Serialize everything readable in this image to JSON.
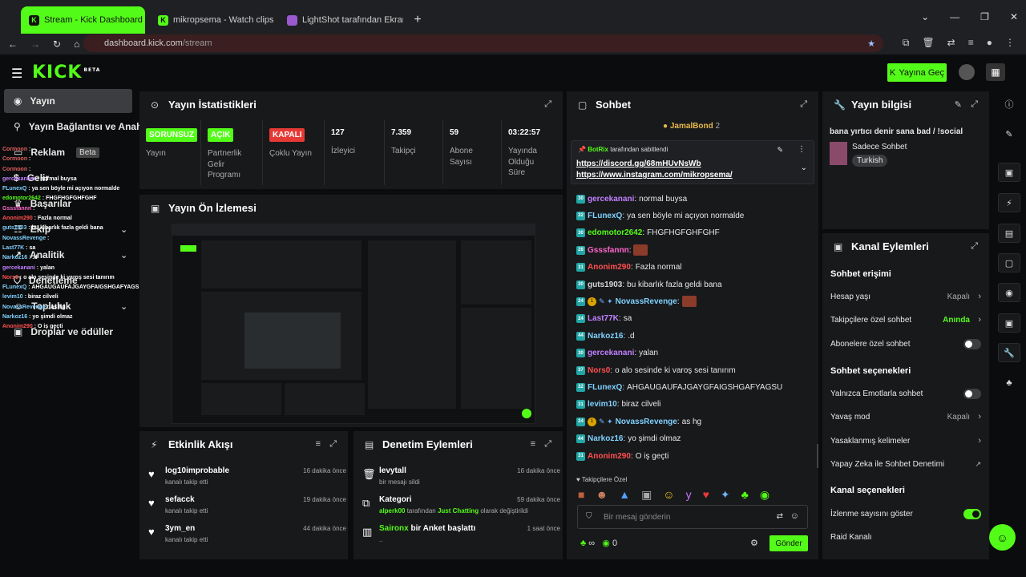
{
  "browser": {
    "tabs": [
      {
        "title": "Stream - Kick Dashboard",
        "active": true
      },
      {
        "title": "mikropsema - Watch clips on K",
        "active": false
      },
      {
        "title": "LightShot tarafından Ekran Gör",
        "active": false
      }
    ],
    "new_tab": "+",
    "url_host": "dashboard.kick.com",
    "url_path": "/stream"
  },
  "header": {
    "logo": "KICK",
    "logo_sup": "BETA",
    "go_live": "Yayına Geç"
  },
  "sidebar": {
    "items": [
      {
        "label": "Yayın",
        "icon": "play-circle-icon"
      },
      {
        "label": "Yayın Bağlantısı ve Anahtarı",
        "icon": "link-icon"
      },
      {
        "label": "Reklam",
        "icon": "ad-icon",
        "badge": "Beta"
      },
      {
        "label": "Gelir",
        "icon": "money-icon"
      },
      {
        "label": "Başarılar",
        "icon": "trophy-icon"
      },
      {
        "label": "Ekip",
        "icon": "team-icon"
      },
      {
        "label": "Analitik",
        "icon": "chart-icon"
      },
      {
        "label": "Denetleme",
        "icon": "shield-icon"
      },
      {
        "label": "Topluluk",
        "icon": "community-icon"
      },
      {
        "label": "Droplar ve ödüller",
        "icon": "gift-icon"
      }
    ],
    "overlay": [
      {
        "u": "Cormoon",
        "m": "",
        "c": "#e06060"
      },
      {
        "u": "Cormoon",
        "m": "",
        "c": "#e06060"
      },
      {
        "u": "Cormoon",
        "m": "",
        "c": "#e06060"
      },
      {
        "u": "gercekanani",
        "m": "normal buysa",
        "c": "#c080ff"
      },
      {
        "u": "FLunexQ",
        "m": "ya sen böyle mi açıyon normalde",
        "c": "#7fd1ff"
      },
      {
        "u": "edomotor2642",
        "m": "FHGFHGFGHFGHF",
        "c": "#53fc18"
      },
      {
        "u": "Gsssfannn",
        "m": "",
        "c": "#ff66cc"
      },
      {
        "u": "Anonim290",
        "m": "Fazla normal",
        "c": "#ff5050"
      },
      {
        "u": "guts1903",
        "m": "bu kibarlık fazla geldi bana",
        "c": "#7fd1ff"
      },
      {
        "u": "NovassRevenge",
        "m": "",
        "c": "#7fd1ff"
      },
      {
        "u": "Last77K",
        "m": "sa",
        "c": "#7fd1ff"
      },
      {
        "u": "Narkoz16",
        "m": ".d",
        "c": "#7fd1ff"
      },
      {
        "u": "gercekanani",
        "m": "yalan",
        "c": "#c080ff"
      },
      {
        "u": "Nors0",
        "m": "o alo sesinde ki varoş sesi tanırım",
        "c": "#ff5050"
      },
      {
        "u": "FLunexQ",
        "m": "AHGAUGAUFAJGAYGFAIGSHGAFYAGSU",
        "c": "#7fd1ff"
      },
      {
        "u": "levim10",
        "m": "biraz cilveli",
        "c": "#7fd1ff"
      },
      {
        "u": "NovassRevenge",
        "m": "as hg",
        "c": "#7fd1ff"
      },
      {
        "u": "Narkoz16",
        "m": "yo şimdi olmaz",
        "c": "#7fd1ff"
      },
      {
        "u": "Anonim290",
        "m": "O iş geçti",
        "c": "#ff5050"
      }
    ]
  },
  "stats": {
    "title": "Yayın İstatistikleri",
    "items": [
      {
        "value": "SORUNSUZ",
        "label": "Yayın",
        "badge": "green"
      },
      {
        "value": "AÇIK",
        "label": "Partnerlik Gelir Programı",
        "badge": "green"
      },
      {
        "value": "KAPALI",
        "label": "Çoklu Yayın",
        "badge": "red"
      },
      {
        "value": "127",
        "label": "İzleyici"
      },
      {
        "value": "7.359",
        "label": "Takipçi"
      },
      {
        "value": "59",
        "label": "Abone Sayısı"
      },
      {
        "value": "03:22:57",
        "label": "Yayında Olduğu Süre"
      }
    ]
  },
  "preview": {
    "title": "Yayın Ön İzlemesi"
  },
  "activity": {
    "title": "Etkinlik Akışı",
    "items": [
      {
        "name": "log10improbable",
        "sub": "kanalı takip etti",
        "time": "16 dakika önce"
      },
      {
        "name": "sefacck",
        "sub": "kanalı takip etti",
        "time": "19 dakika önce"
      },
      {
        "name": "3ym_en",
        "sub": "kanalı takip etti",
        "time": "44 dakika önce"
      }
    ]
  },
  "moderation": {
    "title": "Denetim Eylemleri",
    "items": [
      {
        "name": "levytall",
        "sub": "bir mesajı sildi",
        "time": "16 dakika önce"
      },
      {
        "name": "Kategori",
        "sub_user": "alperk00",
        "sub_mid": "tarafından",
        "sub_cat": "Just Chatting",
        "sub_end": "olarak değiştirildi",
        "time": "59 dakika önce"
      },
      {
        "name": "Saironx",
        "name2": "bir Anket başlattı",
        "sub": "..",
        "time": "1 saat önce"
      }
    ]
  },
  "chat": {
    "title": "Sohbet",
    "top_gifter": "JamalBond",
    "top_gifter_count": "2",
    "pinned": {
      "by": "BotRix",
      "by_text": "tarafından sabitlendi",
      "link1": "https://discord.gg/68mHUvNsWb",
      "link2": "https://www.instagram.com/mikropsema/"
    },
    "messages": [
      {
        "u": "gercekanani",
        "m": "normal buysa",
        "c": "#c080ff",
        "lvl": "30"
      },
      {
        "u": "FLunexQ",
        "m": "ya sen böyle mi açıyon normalde",
        "c": "#7fd1ff",
        "lvl": "32"
      },
      {
        "u": "edomotor2642",
        "m": "FHGFHGFGHFGHF",
        "c": "#53fc18",
        "lvl": "30"
      },
      {
        "u": "Gsssfannn",
        "m": "",
        "c": "#ff66cc",
        "lvl": "28",
        "emote": true
      },
      {
        "u": "Anonim290",
        "m": "Fazla normal",
        "c": "#ff5050",
        "lvl": "31"
      },
      {
        "u": "guts1903",
        "m": "bu kibarlık fazla geldi bana",
        "c": "#d8d8d8",
        "lvl": "30"
      },
      {
        "u": "NovassRevenge",
        "m": "",
        "c": "#7fd1ff",
        "lvl": "24",
        "emote": true,
        "coin": true
      },
      {
        "u": "Last77K",
        "m": "sa",
        "c": "#c080ff",
        "lvl": "24"
      },
      {
        "u": "Narkoz16",
        "m": ".d",
        "c": "#7fd1ff",
        "lvl": "44"
      },
      {
        "u": "gercekanani",
        "m": "yalan",
        "c": "#c080ff",
        "lvl": "30"
      },
      {
        "u": "Nors0",
        "m": "o alo sesinde ki varoş sesi tanırım",
        "c": "#ff5050",
        "lvl": "37"
      },
      {
        "u": "FLunexQ",
        "m": "AHGAUGAUFAJGAYGFAIGSHGAFYAGSU",
        "c": "#7fd1ff",
        "lvl": "32"
      },
      {
        "u": "levim10",
        "m": "biraz cilveli",
        "c": "#7fd1ff",
        "lvl": "31"
      },
      {
        "u": "NovassRevenge",
        "m": "as hg",
        "c": "#7fd1ff",
        "lvl": "24",
        "coin": true
      },
      {
        "u": "Narkoz16",
        "m": "yo şimdi olmaz",
        "c": "#7fd1ff",
        "lvl": "44"
      },
      {
        "u": "Anonim290",
        "m": "O iş geçti",
        "c": "#ff5050",
        "lvl": "31"
      }
    ],
    "followers_only": "Takipçilere Özel",
    "placeholder": "Bir mesaj gönderin",
    "infinity": "∞",
    "count": "0",
    "send": "Gönder"
  },
  "stream_info": {
    "title": "Yayın bilgisi",
    "stream_title": "bana yırtıcı denir sana bad / !social",
    "category": "Sadece Sohbet",
    "language": "Turkish"
  },
  "channel_actions": {
    "title": "Kanal Eylemleri",
    "chat_access": "Sohbet erişimi",
    "rows1": [
      {
        "label": "Hesap yaşı",
        "value": "Kapalı",
        "type": "arrow"
      },
      {
        "label": "Takipçilere özel sohbet",
        "value": "Anında",
        "type": "arrow",
        "green": true
      },
      {
        "label": "Abonelere özel sohbet",
        "type": "toggle",
        "on": false
      }
    ],
    "chat_options": "Sohbet seçenekleri",
    "rows2": [
      {
        "label": "Yalnızca Emotlarla sohbet",
        "type": "toggle",
        "on": false
      },
      {
        "label": "Yavaş mod",
        "value": "Kapalı",
        "type": "arrow"
      },
      {
        "label": "Yasaklanmış kelimeler",
        "type": "arrow"
      },
      {
        "label": "Yapay Zeka ile Sohbet Denetimi",
        "type": "ext"
      }
    ],
    "channel_options": "Kanal seçenekleri",
    "rows3": [
      {
        "label": "İzlenme sayısını göster",
        "type": "toggle",
        "on": true
      },
      {
        "label": "Raid Kanalı",
        "type": "none"
      }
    ]
  },
  "colors": {
    "accent": "#53fc18",
    "panel": "#18191b",
    "bg": "#0b0c0d"
  }
}
